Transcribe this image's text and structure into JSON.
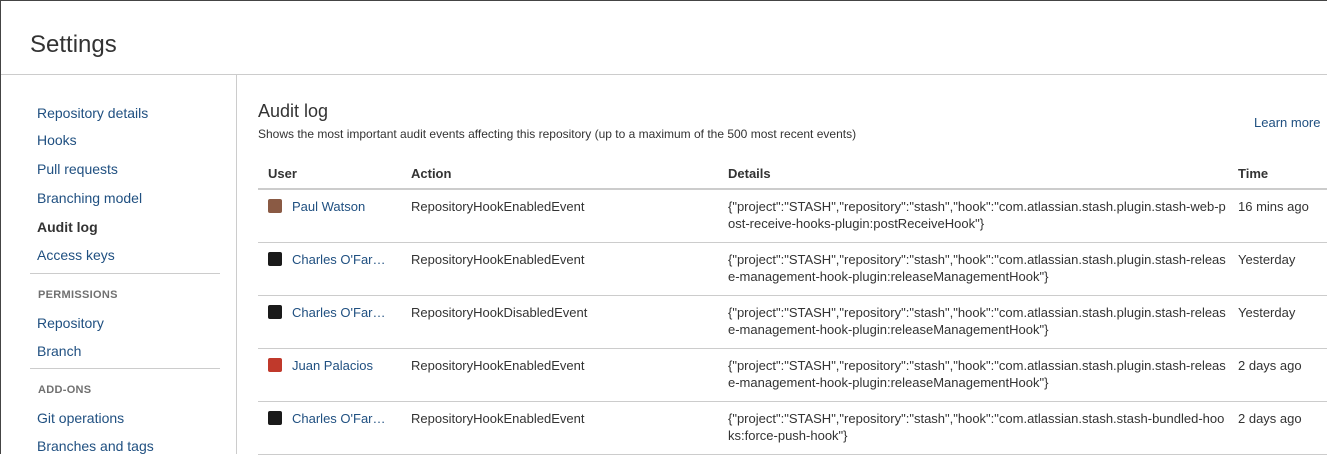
{
  "header": {
    "title": "Settings"
  },
  "sidebar": {
    "items": [
      {
        "label": "Repository details"
      },
      {
        "label": "Hooks"
      },
      {
        "label": "Pull requests"
      },
      {
        "label": "Branching model"
      },
      {
        "label": "Audit log"
      },
      {
        "label": "Access keys"
      }
    ],
    "permissions_heading": "PERMISSIONS",
    "permissions_items": [
      {
        "label": "Repository"
      },
      {
        "label": "Branch"
      }
    ],
    "addons_heading": "ADD-ONS",
    "addons_items": [
      {
        "label": "Git operations"
      },
      {
        "label": "Branches and tags"
      }
    ]
  },
  "main": {
    "title": "Audit log",
    "description": "Shows the most important audit events affecting this repository (up to a maximum of the 500 most recent events)",
    "learn_more": "Learn more",
    "columns": [
      "User",
      "Action",
      "Details",
      "Time"
    ],
    "rows": [
      {
        "user": "Paul Watson",
        "avatar_color": "#8a5a44",
        "action": "RepositoryHookEnabledEvent",
        "details": "{\"project\":\"STASH\",\"repository\":\"stash\",\"hook\":\"com.atlassian.stash.plugin.stash-web-post-receive-hooks-plugin:postReceiveHook\"}",
        "time": "16 mins ago"
      },
      {
        "user": "Charles O'Far…",
        "avatar_color": "#1a1a1a",
        "action": "RepositoryHookEnabledEvent",
        "details": "{\"project\":\"STASH\",\"repository\":\"stash\",\"hook\":\"com.atlassian.stash.plugin.stash-release-management-hook-plugin:releaseManagementHook\"}",
        "time": "Yesterday"
      },
      {
        "user": "Charles O'Far…",
        "avatar_color": "#1a1a1a",
        "action": "RepositoryHookDisabledEvent",
        "details": "{\"project\":\"STASH\",\"repository\":\"stash\",\"hook\":\"com.atlassian.stash.plugin.stash-release-management-hook-plugin:releaseManagementHook\"}",
        "time": "Yesterday"
      },
      {
        "user": "Juan Palacios",
        "avatar_color": "#c0392b",
        "action": "RepositoryHookEnabledEvent",
        "details": "{\"project\":\"STASH\",\"repository\":\"stash\",\"hook\":\"com.atlassian.stash.plugin.stash-release-management-hook-plugin:releaseManagementHook\"}",
        "time": "2 days ago"
      },
      {
        "user": "Charles O'Far…",
        "avatar_color": "#1a1a1a",
        "action": "RepositoryHookEnabledEvent",
        "details": "{\"project\":\"STASH\",\"repository\":\"stash\",\"hook\":\"com.atlassian.stash.stash-bundled-hooks:force-push-hook\"}",
        "time": "2 days ago"
      }
    ]
  },
  "colors": {
    "link": "#205081",
    "border": "#cccccc",
    "text": "#333333"
  }
}
